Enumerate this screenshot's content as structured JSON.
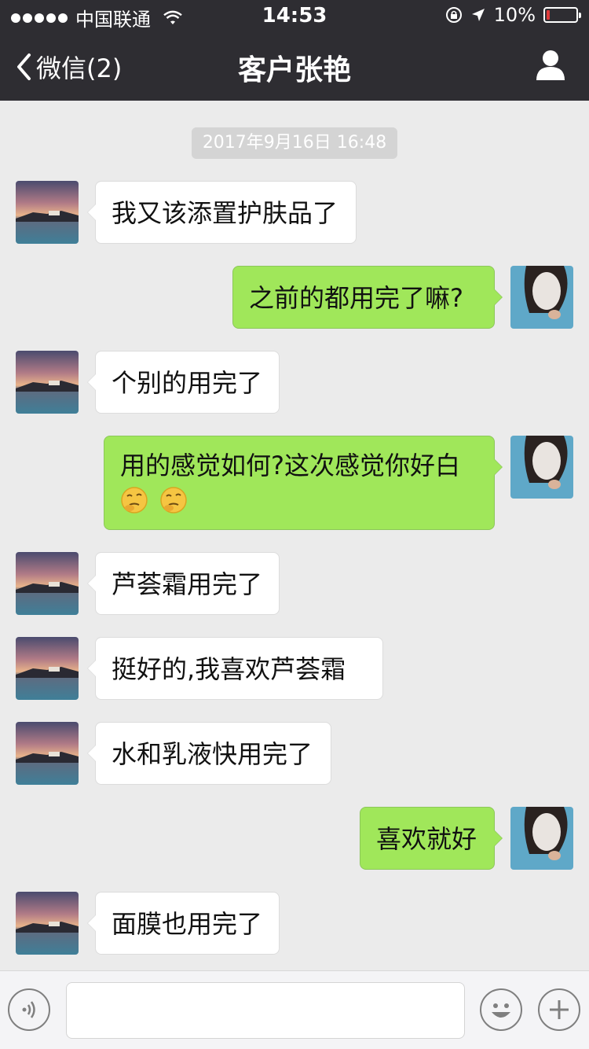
{
  "status_bar": {
    "carrier": "中国联通",
    "time": "14:53",
    "battery": "10%",
    "battery_level": 0.1
  },
  "nav": {
    "back_label": "微信(2)",
    "title": "客户张艳"
  },
  "chat": {
    "timestamp": "2017年9月16日 16:48",
    "messages": [
      {
        "side": "left",
        "text": "我又该添置护肤品了"
      },
      {
        "side": "right",
        "text": "之前的都用完了嘛?"
      },
      {
        "side": "left",
        "text": "个别的用完了"
      },
      {
        "side": "right",
        "text": "用的感觉如何?这次感觉你好白",
        "emoji": [
          "thinking-face-icon",
          "thinking-face-icon"
        ]
      },
      {
        "side": "left",
        "text": "芦荟霜用完了"
      },
      {
        "side": "left",
        "text": "挺好的,我喜欢芦荟霜"
      },
      {
        "side": "left",
        "text": "水和乳液快用完了"
      },
      {
        "side": "right",
        "text": "喜欢就好"
      },
      {
        "side": "left",
        "text": "面膜也用完了"
      }
    ]
  },
  "input_bar": {
    "placeholder": "",
    "icons": [
      "voice-icon",
      "emoji-icon",
      "plus-icon"
    ]
  },
  "colors": {
    "header_bg": "#2e2d32",
    "chat_bg": "#ebebeb",
    "outgoing_bubble": "#a0e75a",
    "incoming_bubble": "#ffffff",
    "battery_low": "#e03a3a"
  }
}
